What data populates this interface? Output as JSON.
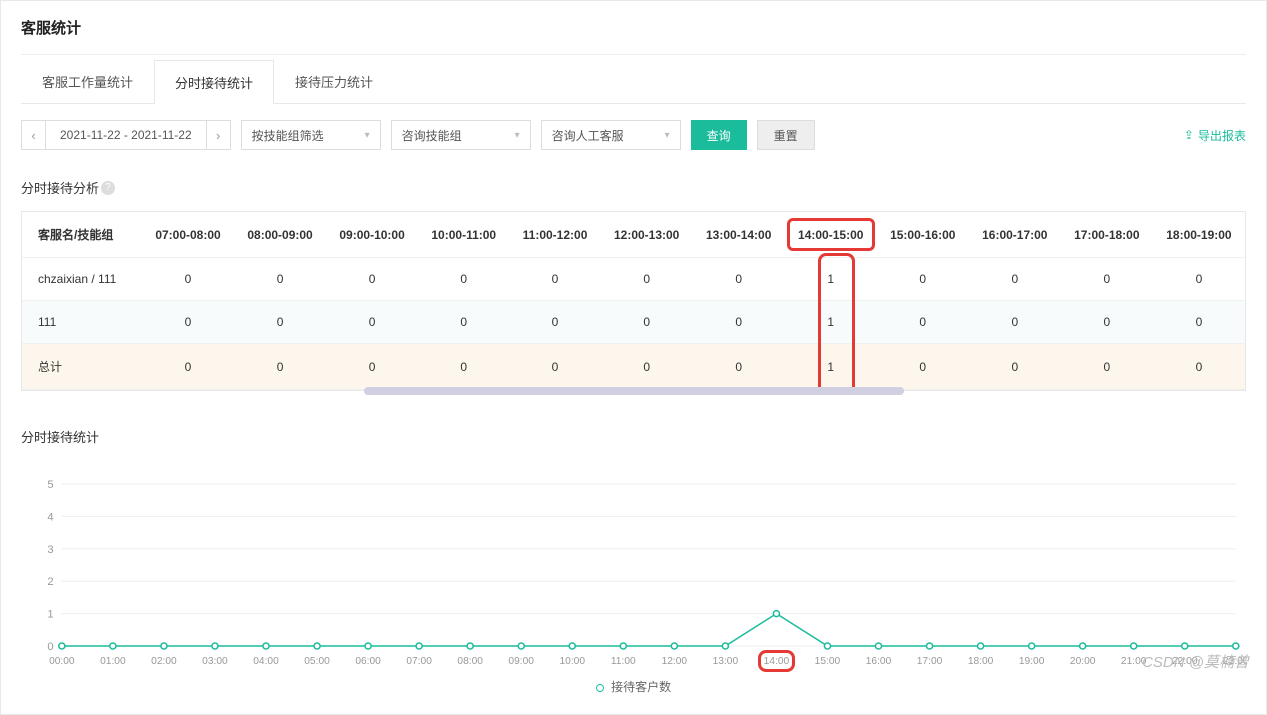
{
  "page_title": "客服统计",
  "tabs": [
    {
      "label": "客服工作量统计",
      "active": false
    },
    {
      "label": "分时接待统计",
      "active": true
    },
    {
      "label": "接待压力统计",
      "active": false
    }
  ],
  "toolbar": {
    "date_range": "2021-11-22 - 2021-11-22",
    "filter1": "按技能组筛选",
    "filter2": "咨询技能组",
    "filter3": "咨询人工客服",
    "query_btn": "查询",
    "reset_btn": "重置",
    "export_btn": "导出报表"
  },
  "section1_title": "分时接待分析",
  "table": {
    "col0_header": "客服名/技能组",
    "headers": [
      "07:00-08:00",
      "08:00-09:00",
      "09:00-10:00",
      "10:00-11:00",
      "11:00-12:00",
      "12:00-13:00",
      "13:00-14:00",
      "14:00-15:00",
      "15:00-16:00",
      "16:00-17:00",
      "17:00-18:00",
      "18:00-19:00"
    ],
    "highlighted_header_index": 7,
    "rows": [
      {
        "name": "chzaixian / 111",
        "values": [
          0,
          0,
          0,
          0,
          0,
          0,
          0,
          1,
          0,
          0,
          0,
          0
        ]
      },
      {
        "name": "111",
        "values": [
          0,
          0,
          0,
          0,
          0,
          0,
          0,
          1,
          0,
          0,
          0,
          0
        ]
      },
      {
        "name": "总计",
        "values": [
          0,
          0,
          0,
          0,
          0,
          0,
          0,
          1,
          0,
          0,
          0,
          0
        ],
        "total": true
      }
    ]
  },
  "section2_title": "分时接待统计",
  "chart_data": {
    "type": "line",
    "title": "",
    "xlabel": "",
    "ylabel": "",
    "ylim": [
      0,
      5
    ],
    "yticks": [
      0,
      1,
      2,
      3,
      4,
      5
    ],
    "categories": [
      "00:00",
      "01:00",
      "02:00",
      "03:00",
      "04:00",
      "05:00",
      "06:00",
      "07:00",
      "08:00",
      "09:00",
      "10:00",
      "11:00",
      "12:00",
      "13:00",
      "14:00",
      "15:00",
      "16:00",
      "17:00",
      "18:00",
      "19:00",
      "20:00",
      "21:00",
      "22:00",
      "23:00"
    ],
    "series": [
      {
        "name": "接待客户数",
        "values": [
          0,
          0,
          0,
          0,
          0,
          0,
          0,
          0,
          0,
          0,
          0,
          0,
          0,
          0,
          1,
          0,
          0,
          0,
          0,
          0,
          0,
          0,
          0,
          0
        ]
      }
    ],
    "highlighted_x_index": 14
  },
  "watermark": "CSDN @莫楠曾"
}
